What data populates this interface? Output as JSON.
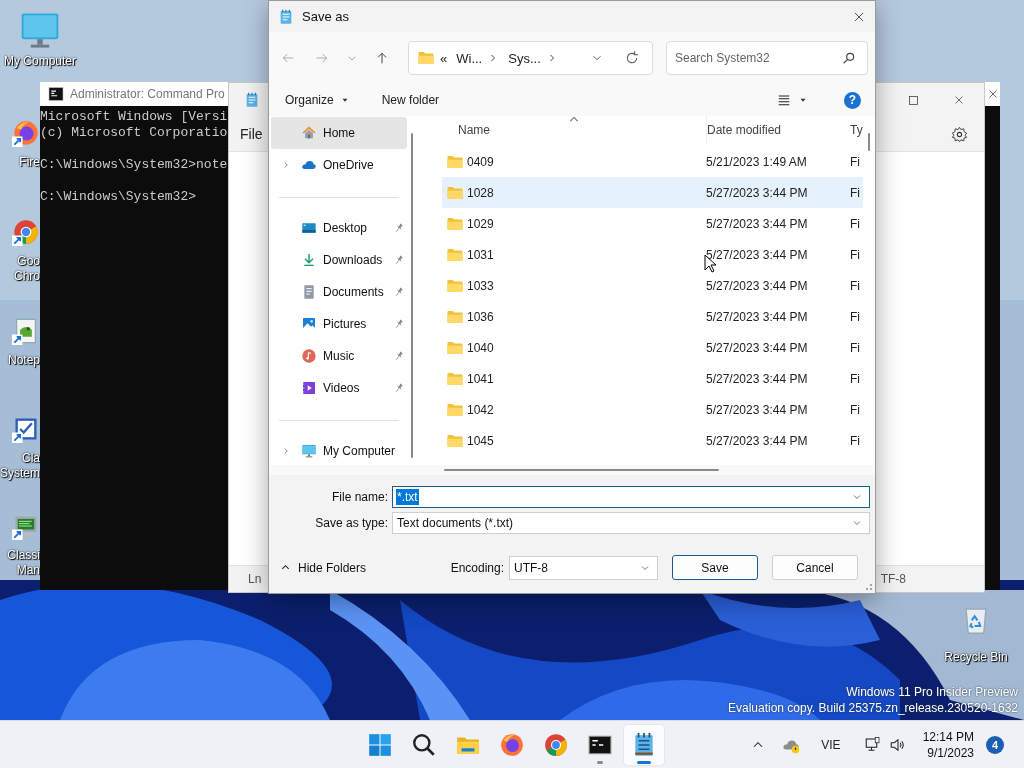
{
  "desktop": {
    "icons": [
      {
        "kind": "monitor",
        "lines": [
          "My Computer"
        ],
        "shortcut": false,
        "covered": false
      },
      {
        "kind": "firefox",
        "lines": [
          "Fire"
        ],
        "shortcut": true,
        "covered": true
      },
      {
        "kind": "chrome",
        "lines": [
          "Goo",
          "Chro"
        ],
        "shortcut": true,
        "covered": true
      },
      {
        "kind": "notepad",
        "lines": [
          "Notep"
        ],
        "shortcut": true,
        "covered": true
      },
      {
        "kind": "checklist",
        "lines": [
          "Cla",
          "System"
        ],
        "shortcut": true,
        "covered": true
      },
      {
        "kind": "manager",
        "lines": [
          "Classi",
          "Man"
        ],
        "shortcut": true,
        "covered": true
      }
    ],
    "recycle_bin": {
      "label": "Recycle Bin"
    },
    "watermark": [
      "Windows 11 Pro Insider Preview",
      "Evaluation copy. Build 25375.zn_release.230520-1632"
    ]
  },
  "cmd_window": {
    "title": "Administrator: Command Pro",
    "blocks": [
      [
        "Microsoft Windows [Versi",
        "(c) Microsoft Corporatio"
      ],
      [
        "C:\\Windows\\System32>note"
      ],
      [
        "C:\\Windows\\System32>"
      ]
    ]
  },
  "notepad_window": {
    "menu": [
      "File"
    ],
    "status_left": "Ln",
    "status_right": "TF-8"
  },
  "dialog": {
    "title": "Save as",
    "address": {
      "overflow": "«",
      "crumbs": [
        "Wi...",
        "Sys..."
      ]
    },
    "search": {
      "placeholder": "Search System32"
    },
    "toolbar": {
      "organize": "Organize",
      "new_folder": "New folder",
      "help": "?"
    },
    "nav_pane": {
      "groups": [
        {
          "items": [
            {
              "kind": "home",
              "label": "Home",
              "selected": true,
              "pinned": false,
              "expandable": false
            },
            {
              "kind": "cloud",
              "label": "OneDrive",
              "selected": false,
              "pinned": false,
              "expandable": true
            }
          ]
        },
        {
          "items": [
            {
              "kind": "desktop",
              "label": "Desktop",
              "selected": false,
              "pinned": true,
              "expandable": false
            },
            {
              "kind": "downloads",
              "label": "Downloads",
              "selected": false,
              "pinned": true,
              "expandable": false
            },
            {
              "kind": "documents",
              "label": "Documents",
              "selected": false,
              "pinned": true,
              "expandable": false
            },
            {
              "kind": "pictures",
              "label": "Pictures",
              "selected": false,
              "pinned": true,
              "expandable": false
            },
            {
              "kind": "music",
              "label": "Music",
              "selected": false,
              "pinned": true,
              "expandable": false
            },
            {
              "kind": "videos",
              "label": "Videos",
              "selected": false,
              "pinned": true,
              "expandable": false
            }
          ]
        },
        {
          "items": [
            {
              "kind": "monitor",
              "label": "My Computer",
              "selected": false,
              "pinned": false,
              "expandable": true
            }
          ]
        }
      ]
    },
    "columns": [
      {
        "label": "Name",
        "sorted": true
      },
      {
        "label": "Date modified",
        "sorted": false
      },
      {
        "label": "Ty",
        "sorted": false
      }
    ],
    "rows": [
      {
        "name": "0409",
        "date": "5/21/2023 1:49 AM",
        "type": "Fi",
        "hovered": false
      },
      {
        "name": "1028",
        "date": "5/27/2023 3:44 PM",
        "type": "Fi",
        "hovered": true
      },
      {
        "name": "1029",
        "date": "5/27/2023 3:44 PM",
        "type": "Fi",
        "hovered": false
      },
      {
        "name": "1031",
        "date": "5/27/2023 3:44 PM",
        "type": "Fi",
        "hovered": false
      },
      {
        "name": "1033",
        "date": "5/27/2023 3:44 PM",
        "type": "Fi",
        "hovered": false
      },
      {
        "name": "1036",
        "date": "5/27/2023 3:44 PM",
        "type": "Fi",
        "hovered": false
      },
      {
        "name": "1040",
        "date": "5/27/2023 3:44 PM",
        "type": "Fi",
        "hovered": false
      },
      {
        "name": "1041",
        "date": "5/27/2023 3:44 PM",
        "type": "Fi",
        "hovered": false
      },
      {
        "name": "1042",
        "date": "5/27/2023 3:44 PM",
        "type": "Fi",
        "hovered": false
      },
      {
        "name": "1045",
        "date": "5/27/2023 3:44 PM",
        "type": "Fi",
        "hovered": false
      }
    ],
    "file_name": {
      "label": "File name:",
      "value": "*.txt",
      "value_selected": true
    },
    "save_as_type": {
      "label": "Save as type:",
      "value": "Text documents (*.txt)"
    },
    "hide_folders": "Hide Folders",
    "encoding": {
      "label": "Encoding:",
      "value": "UTF-8"
    },
    "buttons": [
      {
        "label": "Save",
        "default": true
      },
      {
        "label": "Cancel",
        "default": false
      }
    ]
  },
  "taskbar": {
    "apps": [
      {
        "kind": "start",
        "running": false,
        "active": false
      },
      {
        "kind": "search",
        "running": false,
        "active": false
      },
      {
        "kind": "explorer",
        "running": false,
        "active": false
      },
      {
        "kind": "firefox",
        "running": false,
        "active": false
      },
      {
        "kind": "chrome",
        "running": false,
        "active": false
      },
      {
        "kind": "terminal",
        "running": true,
        "active": false
      },
      {
        "kind": "notepad",
        "running": true,
        "active": true
      }
    ],
    "language": "VIE",
    "time": "12:14 PM",
    "date": "9/1/2023",
    "notifications": "4"
  }
}
